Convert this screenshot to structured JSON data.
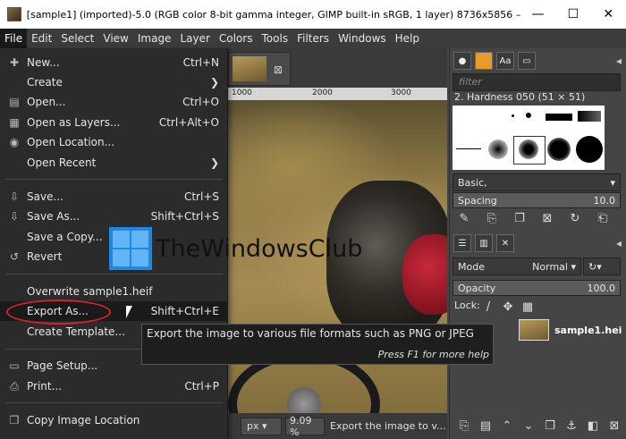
{
  "window": {
    "title": "[sample1] (imported)-5.0 (RGB color 8-bit gamma integer, GIMP built-in sRGB, 1 layer) 8736x5856 – GI...",
    "minimize": "—",
    "maximize": "☐",
    "close": "✕"
  },
  "menubar": [
    "File",
    "Edit",
    "Select",
    "View",
    "Image",
    "Layer",
    "Colors",
    "Tools",
    "Filters",
    "Windows",
    "Help"
  ],
  "file_menu": {
    "new": {
      "label": "New...",
      "shortcut": "Ctrl+N"
    },
    "create": {
      "label": "Create"
    },
    "open": {
      "label": "Open...",
      "shortcut": "Ctrl+O"
    },
    "open_as_layers": {
      "label": "Open as Layers...",
      "shortcut": "Ctrl+Alt+O"
    },
    "open_location": {
      "label": "Open Location..."
    },
    "open_recent": {
      "label": "Open Recent"
    },
    "save": {
      "label": "Save...",
      "shortcut": "Ctrl+S"
    },
    "save_as": {
      "label": "Save As...",
      "shortcut": "Shift+Ctrl+S"
    },
    "save_copy": {
      "label": "Save a Copy..."
    },
    "revert": {
      "label": "Revert"
    },
    "overwrite": {
      "label": "Overwrite sample1.heif"
    },
    "export_as": {
      "label": "Export As...",
      "shortcut": "Shift+Ctrl+E"
    },
    "create_template": {
      "label": "Create Template..."
    },
    "page_setup": {
      "label": "Page Setup..."
    },
    "print": {
      "label": "Print...",
      "shortcut": "Ctrl+P"
    },
    "copy_location": {
      "label": "Copy Image Location"
    }
  },
  "tooltip": {
    "text": "Export the image to various file formats such as PNG or JPEG",
    "hint": "Press F1 for more help"
  },
  "watermark": "TheWindowsClub",
  "ruler": [
    "1000",
    "2000",
    "3000"
  ],
  "statusbar": {
    "unit": "px",
    "zoom": "9.09 %",
    "message": "Export the image to v..."
  },
  "dock": {
    "filter_placeholder": "filter",
    "brush_name": "2. Hardness 050 (51 × 51)",
    "preset": "Basic,",
    "spacing_label": "Spacing",
    "spacing_value": "10.0",
    "mode_label": "Mode",
    "mode_value": "Normal",
    "opacity_label": "Opacity",
    "opacity_value": "100.0",
    "lock_label": "Lock:",
    "layer_name": "sample1.hei"
  }
}
